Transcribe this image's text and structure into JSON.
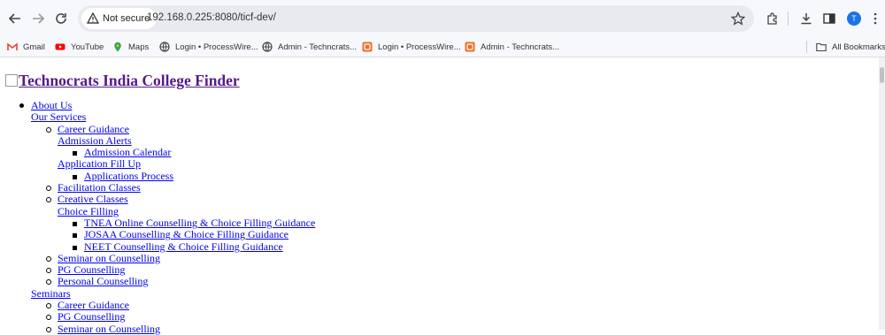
{
  "browser": {
    "security_label": "Not secure",
    "url": "192.168.0.225:8080/ticf-dev/",
    "profile_initial": "T"
  },
  "bookmarks": [
    {
      "label": "Gmail",
      "icon": "gmail-icon"
    },
    {
      "label": "YouTube",
      "icon": "youtube-icon"
    },
    {
      "label": "Maps",
      "icon": "maps-icon"
    },
    {
      "label": "Login • ProcessWire...",
      "icon": "globe-icon"
    },
    {
      "label": "Admin - Techncrats...",
      "icon": "globe-icon"
    },
    {
      "label": "Login • ProcessWire...",
      "icon": "processwire-icon"
    },
    {
      "label": "Admin - Techncrats...",
      "icon": "processwire-icon"
    }
  ],
  "all_bookmarks_label": "All Bookmarks",
  "site": {
    "title": "Technocrats India College Finder",
    "menu": {
      "about": "About Us",
      "services": {
        "label": "Our Services",
        "items": {
          "career": "Career Guidance",
          "admission_alerts": "Admission Alerts",
          "admission_calendar": "Admission Calendar",
          "application_fill_up": "Application Fill Up",
          "applications_process": "Applications Process",
          "facilitation": "Facilitation Classes",
          "creative": "Creative Classes",
          "choice_filling": "Choice Filling",
          "tnea": "TNEA Online Counselling & Choice Filling Guidance",
          "josaa": "JOSAA Counselling & Choice Filling Guidance",
          "neet": "NEET Counselling & Choice Filling Guidance",
          "seminar_counselling": "Seminar on Counselling",
          "pg": "PG Counselling",
          "personal": "Personal Counselling"
        }
      },
      "seminars": {
        "label": "Seminars",
        "items": {
          "career": "Career Guidance",
          "pg": "PG Counselling",
          "seminar_counselling": "Seminar on Counselling"
        }
      }
    }
  },
  "colors": {
    "link": "#0000ee",
    "visited_link": "#551a8b",
    "profile": "#1a73e8"
  }
}
